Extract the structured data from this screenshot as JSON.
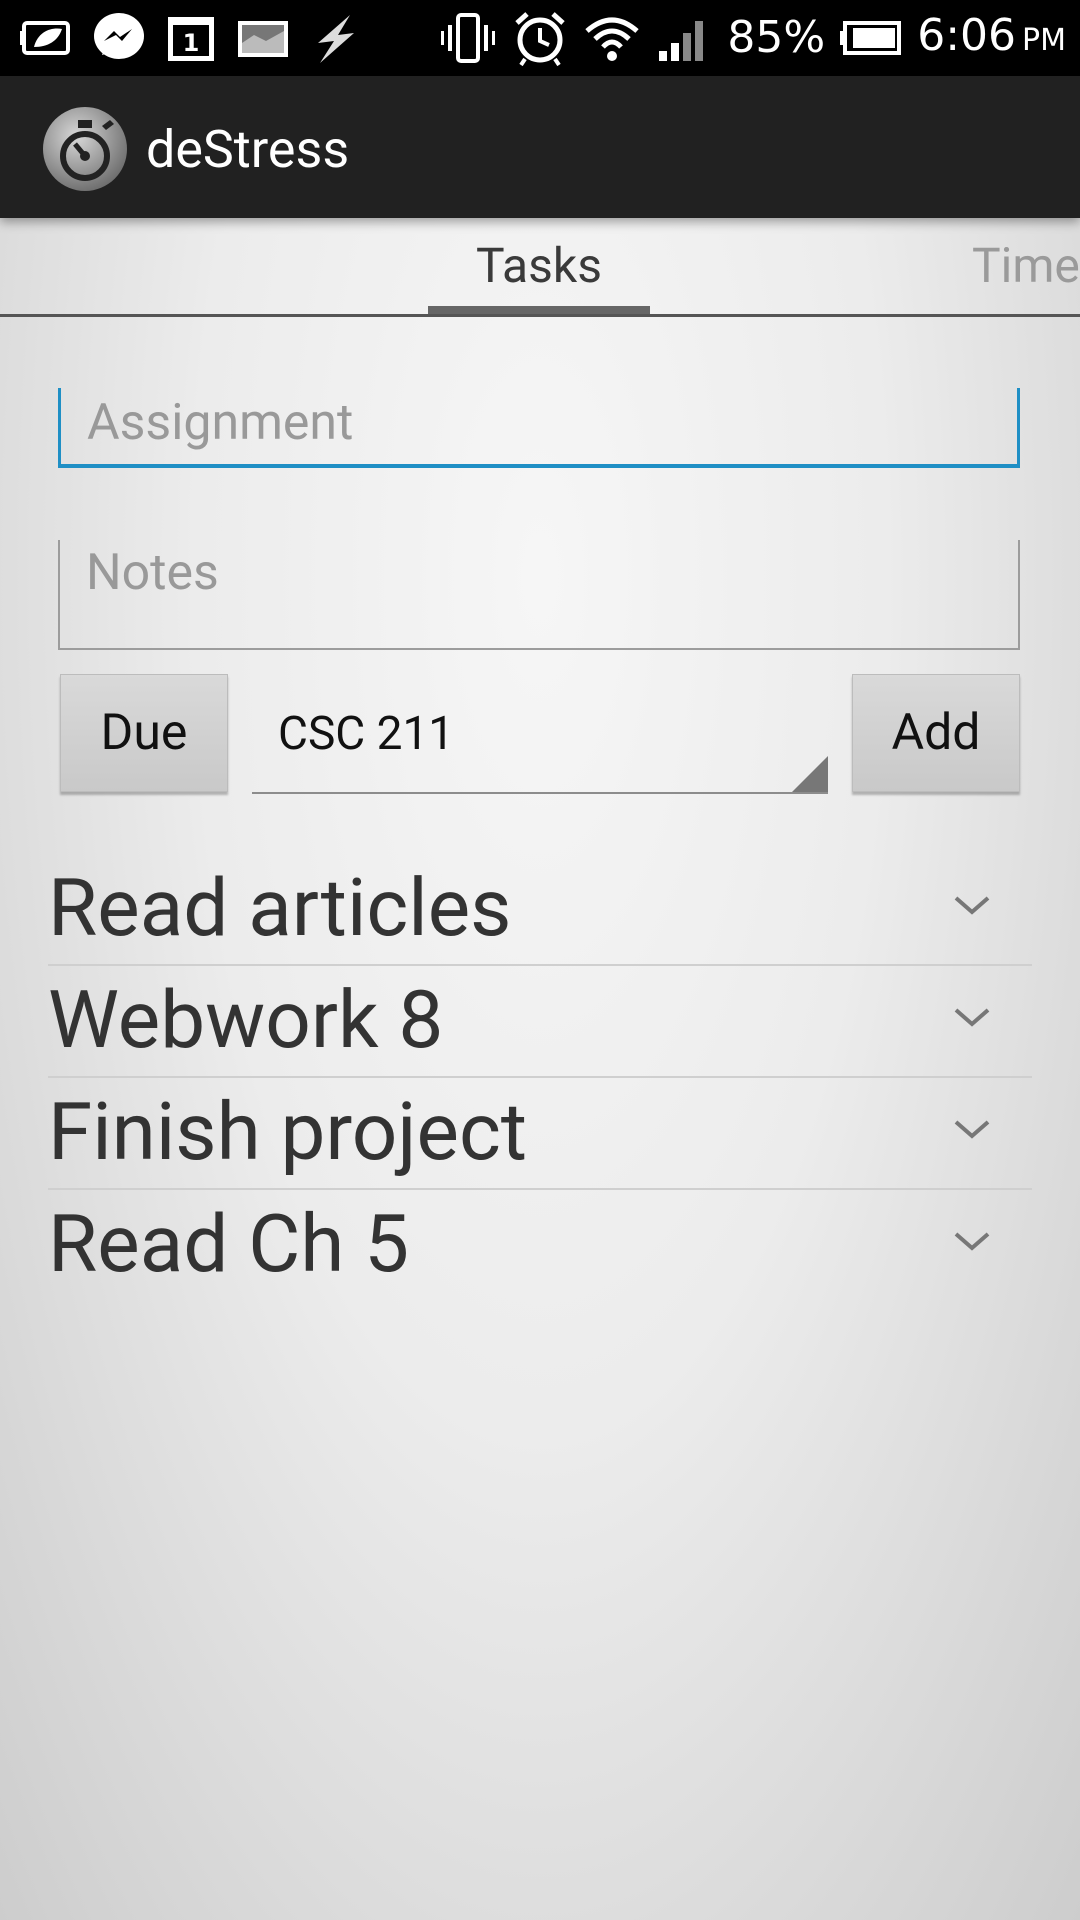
{
  "status_bar": {
    "battery_percent": "85%",
    "time": "6:06",
    "ampm": "PM",
    "left_icons": [
      "battery-saver-icon",
      "messenger-icon",
      "calendar-icon",
      "gallery-icon",
      "flash-icon"
    ],
    "right_icons": [
      "vibrate-icon",
      "alarm-icon",
      "wifi-icon",
      "signal-icon",
      "battery-icon"
    ]
  },
  "action_bar": {
    "title": "deStress",
    "icon": "stopwatch-icon"
  },
  "tabs": {
    "items": [
      {
        "label": "Tasks",
        "selected": true
      },
      {
        "label": "Time",
        "selected": false
      }
    ]
  },
  "form": {
    "assignment_placeholder": "Assignment",
    "notes_placeholder": "Notes",
    "due_label": "Due",
    "course_value": "CSC 211",
    "add_label": "Add"
  },
  "tasks": [
    {
      "title": "Read articles"
    },
    {
      "title": "Webwork 8"
    },
    {
      "title": "Finish project"
    },
    {
      "title": "Read Ch 5"
    }
  ],
  "colors": {
    "accent": "#1f8fc5",
    "action_bar": "#212121"
  }
}
